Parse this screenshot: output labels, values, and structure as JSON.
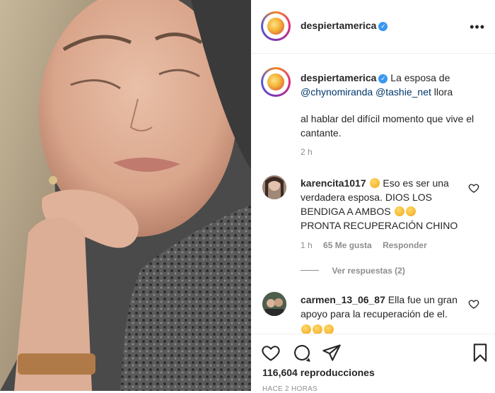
{
  "post": {
    "username": "despiertamerica",
    "more_label": "•••",
    "caption_parts": [
      "La esposa de",
      "@chynomiranda",
      "@tashie_net",
      "llora",
      "al hablar del difícil momento que vive el cantante."
    ],
    "caption_time": "2 h"
  },
  "comments": [
    {
      "username": "karencita1017",
      "text": "Eso es ser una verdadera esposa. DIOS LOS BENDIGA A AMBOS",
      "text_tail": "PRONTA RECUPERACIÓN CHINO",
      "time": "1 h",
      "likes": "65 Me gusta",
      "reply": "Responder",
      "view_replies": "Ver respuestas (2)"
    },
    {
      "username": "carmen_13_06_87",
      "text": "Ella fue un gran apoyo para la recuperación de el."
    }
  ],
  "footer": {
    "views": "116,604 reproducciones",
    "ago": "HACE 2 HORAS"
  },
  "icons": [
    "heart-icon",
    "comment-icon",
    "share-icon",
    "bookmark-icon",
    "verified-badge-icon",
    "more-icon"
  ],
  "colors": {
    "verified": "#3897f0",
    "link": "#00376b",
    "meta": "#8e8e8e"
  }
}
